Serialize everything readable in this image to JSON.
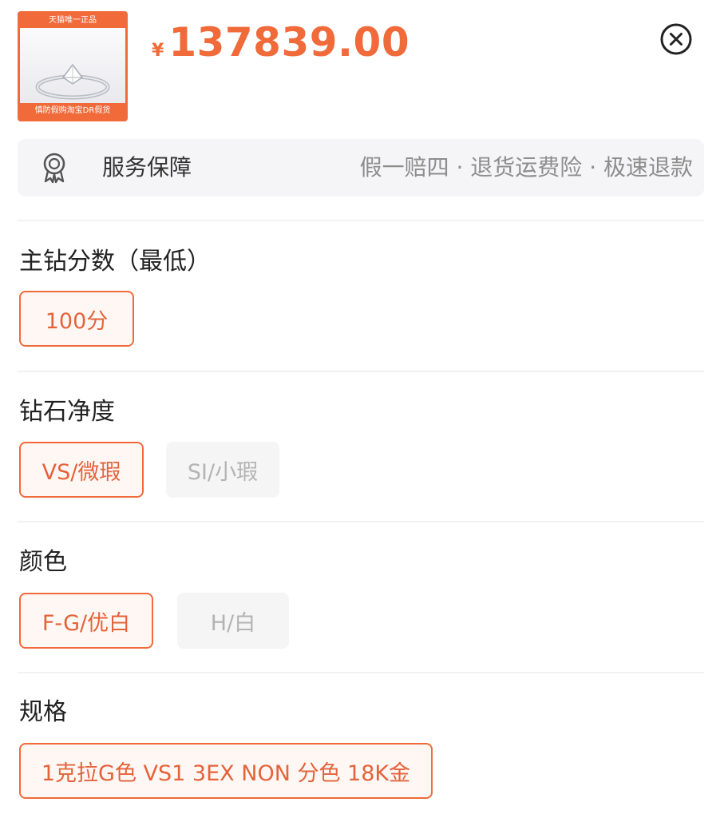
{
  "product": {
    "thumbnail": {
      "top_banner": "天猫唯一正品",
      "bottom_banner": "慎防假购淘宝DR假货",
      "image_icon": "diamond-ring"
    },
    "currency_symbol": "¥",
    "price": "137839.00",
    "close_icon": "circle-x-icon"
  },
  "service": {
    "icon": "badge-ribbon-icon",
    "label": "服务保障",
    "detail": "假一赔四 · 退货运费险 · 极速退款"
  },
  "sections": [
    {
      "title": "主钻分数（最低）",
      "options": [
        {
          "label": "100分",
          "state": "selected"
        }
      ]
    },
    {
      "title": "钻石净度",
      "options": [
        {
          "label": "VS/微瑕",
          "state": "selected"
        },
        {
          "label": "SI/小瑕",
          "state": "disabled"
        }
      ]
    },
    {
      "title": "颜色",
      "options": [
        {
          "label": "F-G/优白",
          "state": "selected"
        },
        {
          "label": "H/白",
          "state": "disabled"
        }
      ]
    },
    {
      "title": "规格",
      "options": [
        {
          "label": "1克拉G色 VS1 3EX NON 分色 18K金",
          "state": "selected"
        }
      ]
    }
  ],
  "colors": {
    "accent": "#f06a3a",
    "accent_text": "#e4633a",
    "muted_text": "#8d8d8d",
    "disabled_bg": "#f5f5f5",
    "disabled_text": "#b3b3b3"
  }
}
